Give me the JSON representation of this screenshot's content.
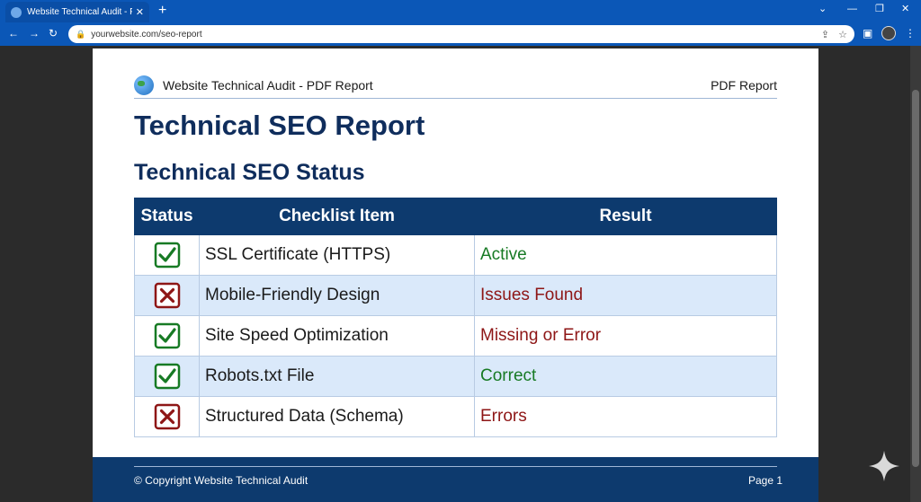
{
  "browser": {
    "tab_title": "Website Technical Audit - PDF",
    "url": "yourwebsite.com/seo-report"
  },
  "report": {
    "header_title": "Website Technical Audit - PDF Report",
    "header_right": "PDF Report",
    "title": "Technical SEO Report",
    "section_title": "Technical SEO Status",
    "columns": [
      "Status",
      "Checklist Item",
      "Result"
    ],
    "rows": [
      {
        "status": "pass",
        "item": "SSL Certificate (HTTPS)",
        "result": "Active"
      },
      {
        "status": "fail",
        "item": "Mobile-Friendly Design",
        "result": "Issues Found"
      },
      {
        "status": "pass",
        "item": "Site Speed Optimization",
        "result": "Missing or Error"
      },
      {
        "status": "pass",
        "item": "Robots.txt File",
        "result": "Correct"
      },
      {
        "status": "fail",
        "item": "Structured Data (Schema)",
        "result": "Errors"
      }
    ],
    "footer_left": "© Copyright Website Technical Audit",
    "footer_right": "Page 1"
  },
  "colors": {
    "chrome": "#0b57b7",
    "brand": "#0d3a6e",
    "pass": "#177a24",
    "fail": "#8e1616",
    "row_alt": "#dae9fa"
  }
}
